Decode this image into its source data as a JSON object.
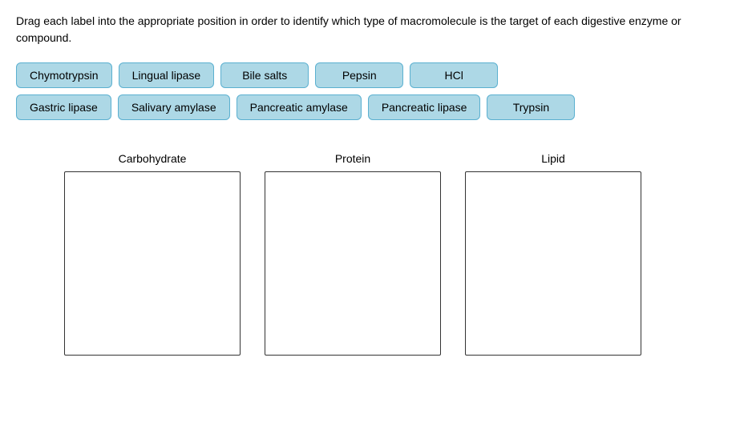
{
  "instructions": {
    "text": "Drag each label into the appropriate position in order to identify which type of macromolecule is the target of each digestive enzyme or compound."
  },
  "labels": {
    "row1": [
      {
        "id": "chymotrypsin",
        "text": "Chymotrypsin"
      },
      {
        "id": "lingual-lipase",
        "text": "Lingual lipase"
      },
      {
        "id": "bile-salts",
        "text": "Bile salts"
      },
      {
        "id": "pepsin",
        "text": "Pepsin"
      },
      {
        "id": "hcl",
        "text": "HCl"
      }
    ],
    "row2": [
      {
        "id": "gastric-lipase",
        "text": "Gastric lipase"
      },
      {
        "id": "salivary-amylase",
        "text": "Salivary amylase"
      },
      {
        "id": "pancreatic-amylase",
        "text": "Pancreatic amylase"
      },
      {
        "id": "pancreatic-lipase",
        "text": "Pancreatic lipase"
      },
      {
        "id": "trypsin",
        "text": "Trypsin"
      }
    ]
  },
  "drop_zones": [
    {
      "id": "carbohydrate",
      "label": "Carbohydrate"
    },
    {
      "id": "protein",
      "label": "Protein"
    },
    {
      "id": "lipid",
      "label": "Lipid"
    }
  ]
}
